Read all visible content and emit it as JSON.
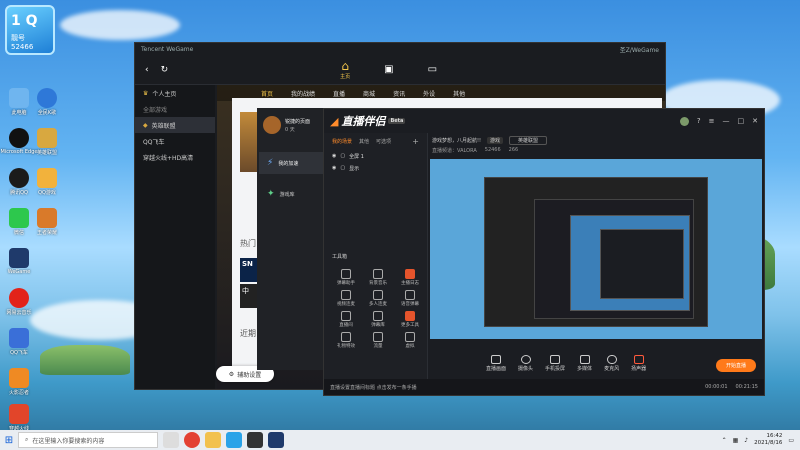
{
  "desktop": {
    "badge": {
      "line1": "1 Q",
      "line2": "靓号",
      "line3": "52466"
    },
    "icons": [
      {
        "label": "此电脑"
      },
      {
        "label": "全民K歌"
      },
      {
        "label": "Microsoft Edge"
      },
      {
        "label": "英雄联盟"
      },
      {
        "label": "腾讯QQ"
      },
      {
        "label": "QQ游戏"
      },
      {
        "label": "微信"
      },
      {
        "label": "王者荣耀"
      },
      {
        "label": "WeGame"
      },
      {
        "label": "网易云音乐"
      },
      {
        "label": "QQ飞车"
      },
      {
        "label": "火影忍者"
      },
      {
        "label": "穿越火线"
      }
    ]
  },
  "wegame": {
    "title": "Tencent WeGame",
    "nav_home": "主页",
    "user": "圣Z/WeGame",
    "side": [
      {
        "label": "个人主页"
      },
      {
        "label": "全部游戏"
      },
      {
        "label": "英雄联盟"
      },
      {
        "label": "QQ飞车"
      },
      {
        "label": "穿越火线+HD高清"
      }
    ],
    "tabs": [
      "首页",
      "我的战绩",
      "直播",
      "商城",
      "资讯",
      "外设",
      "其他"
    ]
  },
  "booster": {
    "hot": "热门",
    "near": "近期",
    "sn": "SN",
    "zh": "中",
    "settings_btn": "辅助设置"
  },
  "panel": {
    "name": "锐捷的页面",
    "sub": "0 天",
    "item1": "我的加速",
    "item2": "游戏库"
  },
  "live": {
    "logo": "直播伴侣",
    "beta": "Beta",
    "scene_tabs": [
      "我的场景",
      "其他",
      "可选项"
    ],
    "scenes": [
      "全屏 1",
      "显示"
    ],
    "live_title": "游戏梦想，八月起航!!",
    "category": "游戏",
    "category_select": "英雄联盟",
    "room_label": "直播频道：VALORA",
    "room_id": "52466",
    "viewers": "266",
    "tools_title": "工具箱",
    "tools": [
      "弹幕助手",
      "背景音乐",
      "主播日志",
      "视频连麦",
      "多人连麦",
      "语音弹幕",
      "直播间",
      "弹幕库",
      "更多工具",
      "礼物特效",
      "流量",
      "虚拟"
    ],
    "controls": [
      "直播画面",
      "摄像头",
      "手机投屏",
      "多媒体",
      "麦克风",
      "扬声器"
    ],
    "go_live": "开始直播",
    "status": "直播设置直播间标题  点击发布一条手播",
    "time1": "00:00:01",
    "time2": "00:21:15"
  },
  "taskbar": {
    "search": "在这里输入你要搜索的内容",
    "time": "16:42",
    "date": "2021/8/16"
  },
  "colors": {
    "accent": "#ff7a1a",
    "gold": "#f3c64b"
  }
}
